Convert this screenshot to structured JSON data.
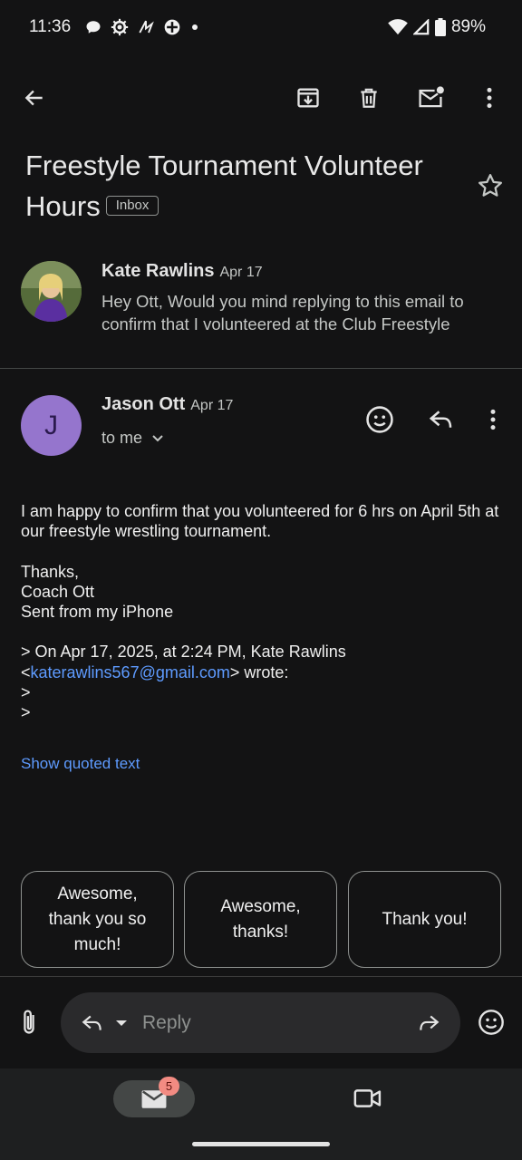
{
  "status_bar": {
    "time": "11:36",
    "battery": "89%",
    "icons": [
      "chat-bubble-icon",
      "settings-gear-icon",
      "activity-icon",
      "vpn-icon",
      "dot-icon",
      "wifi-icon",
      "signal-icon",
      "battery-icon"
    ]
  },
  "toolbar": {
    "icons": [
      "back-arrow-icon",
      "archive-icon",
      "delete-icon",
      "mark-unread-icon",
      "more-vert-icon"
    ]
  },
  "email": {
    "subject": "Freestyle Tournament Volunteer Hours",
    "label": "Inbox"
  },
  "messages": [
    {
      "sender": "Kate Rawlins",
      "date": "Apr 17",
      "snippet": "Hey Ott, Would you mind replying to this email to confirm that I volunteered at the Club Freestyle"
    },
    {
      "sender": "Jason Ott",
      "date": "Apr 17",
      "avatar_letter": "J",
      "recipient": "to me",
      "body": {
        "line1": "I am happy to confirm that you volunteered for 6 hrs on April 5th at our freestyle wrestling tournament.",
        "thanks": "Thanks,",
        "signature": "Coach Ott",
        "sent_from": "Sent from my iPhone",
        "quote_header": "> On Apr 17, 2025, at 2:24 PM, Kate Rawlins",
        "quote_lt": "<",
        "quote_email": "katerawlins567@gmail.com",
        "quote_gt_wrote": "> wrote:",
        "quote_line1": ">",
        "quote_line2": ">"
      },
      "show_quoted": "Show quoted text"
    }
  ],
  "smart_replies": [
    "Awesome, thank you so much!",
    "Awesome, thanks!",
    "Thank you!"
  ],
  "reply_bar": {
    "placeholder": "Reply"
  },
  "bottom_nav": {
    "mail_badge": "5"
  },
  "colors": {
    "background": "#131314",
    "link": "#5e9bff",
    "avatar_j": "#9575cd",
    "badge": "#f28b82"
  }
}
